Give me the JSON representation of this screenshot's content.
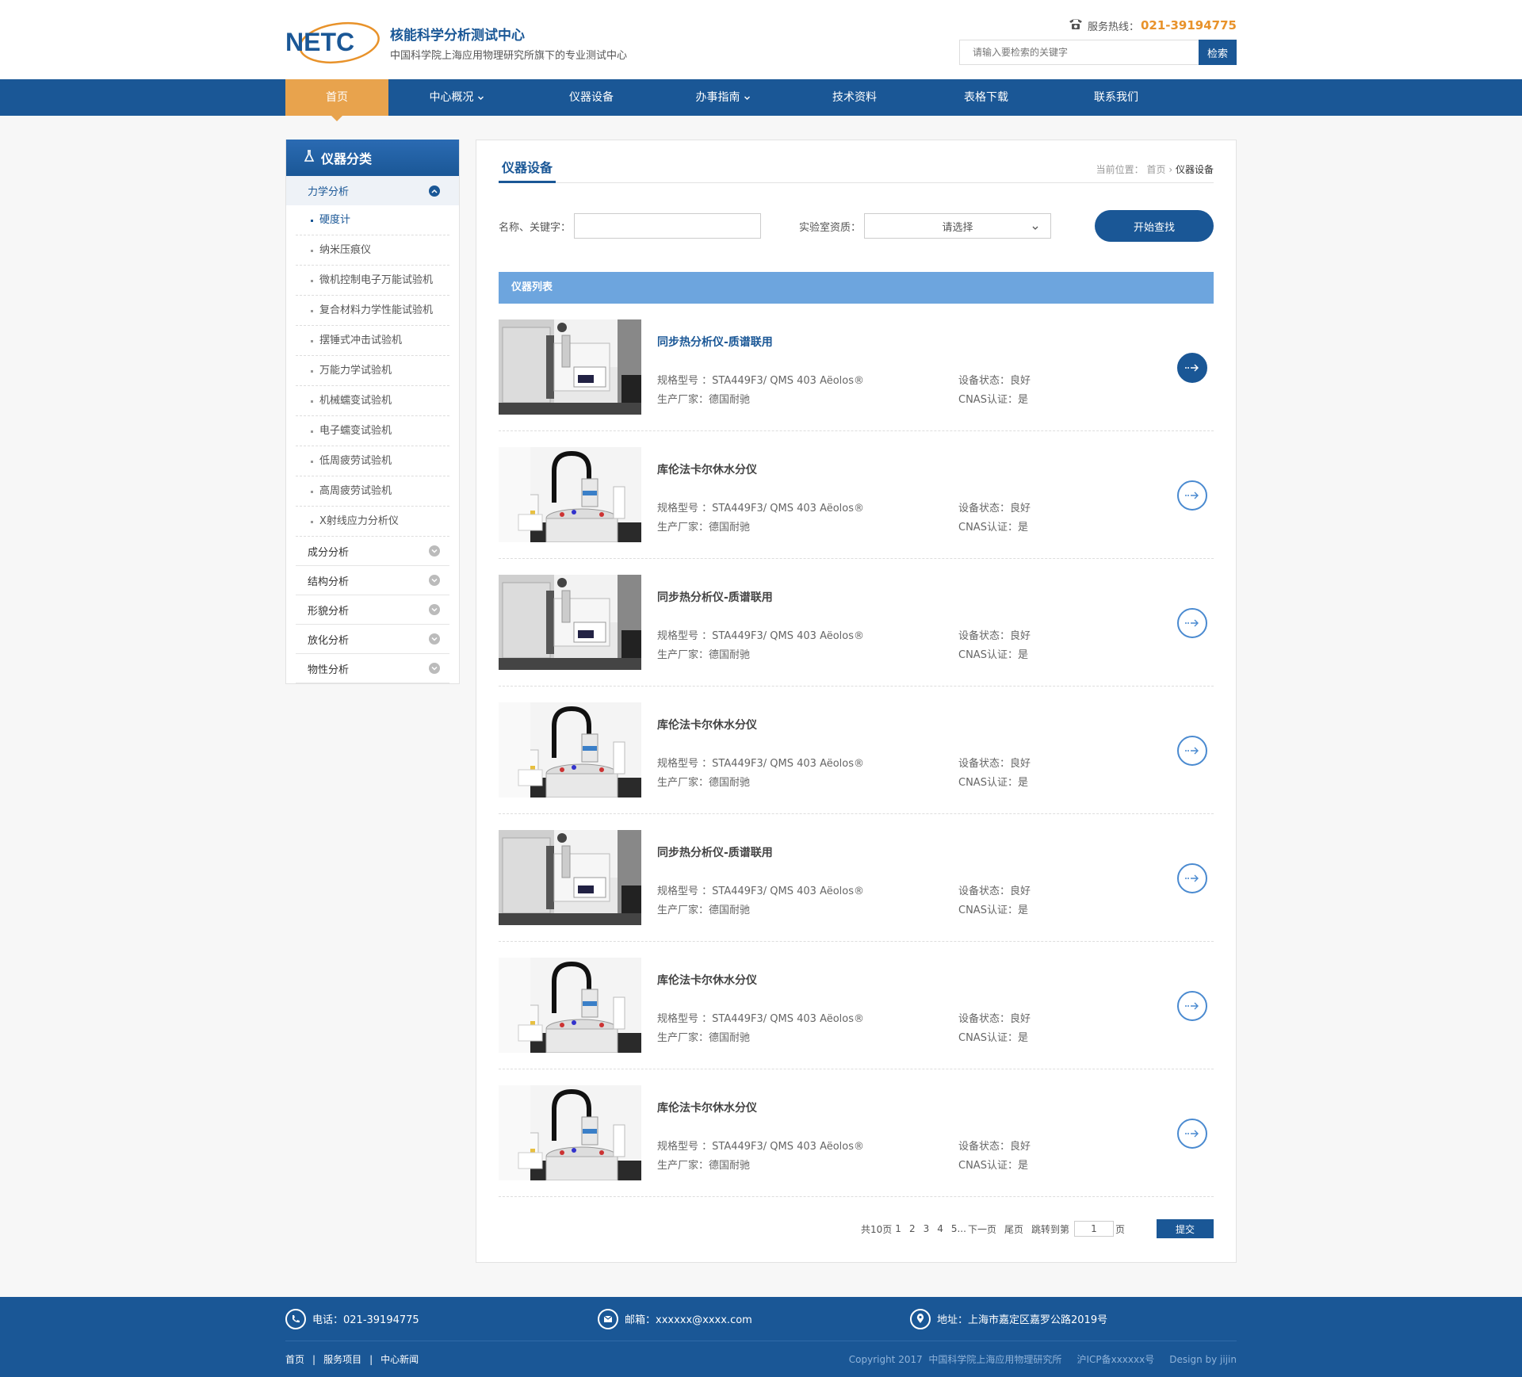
{
  "header": {
    "logo_text": "NETC",
    "title": "核能科学分析测试中心",
    "subtitle": "中国科学院上海应用物理研究所旗下的专业测试中心",
    "hotline_label": "服务热线：",
    "hotline_number": "021-39194775",
    "search_placeholder": "请输入要检索的关键字",
    "search_button": "检索"
  },
  "nav": [
    {
      "label": "首页",
      "active": true
    },
    {
      "label": "中心概况",
      "dropdown": true
    },
    {
      "label": "仪器设备"
    },
    {
      "label": "办事指南",
      "dropdown": true
    },
    {
      "label": "技术资料"
    },
    {
      "label": "表格下载"
    },
    {
      "label": "联系我们"
    }
  ],
  "sidebar": {
    "title": "仪器分类",
    "open_category": "力学分析",
    "sub_items": [
      "硬度计",
      "纳米压痕仪",
      "微机控制电子万能试验机",
      "复合材料力学性能试验机",
      "摆锤式冲击试验机",
      "万能力学试验机",
      "机械蠕变试验机",
      "电子蠕变试验机",
      "低周疲劳试验机",
      "高周疲劳试验机",
      "X射线应力分析仪"
    ],
    "categories": [
      "成分分析",
      "结构分析",
      "形貌分析",
      "放化分析",
      "物性分析"
    ]
  },
  "content": {
    "title": "仪器设备",
    "breadcrumb_prefix": "当前位置：",
    "breadcrumb_home": "首页",
    "breadcrumb_sep": "›",
    "breadcrumb_current": "仪器设备",
    "filter_name_label": "名称、关键字：",
    "filter_lab_label": "实验室资质：",
    "filter_select_value": "请选择",
    "search_button": "开始查找",
    "list_title": "仪器列表",
    "model_label": "规格型号 ：",
    "maker_label": "生产厂家：",
    "status_label": "设备状态：",
    "cnas_label": "CNAS认证：",
    "items": [
      {
        "name": "同步热分析仪-质谱联用",
        "model": "STA449F3/ QMS 403 Aëolos®",
        "maker": "德国耐驰",
        "status": "良好",
        "cnas": "是",
        "img": "sta",
        "active": true
      },
      {
        "name": "库伦法卡尔休水分仪",
        "model": "STA449F3/ QMS 403 Aëolos®",
        "maker": "德国耐驰",
        "status": "良好",
        "cnas": "是",
        "img": "kf"
      },
      {
        "name": "同步热分析仪-质谱联用",
        "model": "STA449F3/ QMS 403 Aëolos®",
        "maker": "德国耐驰",
        "status": "良好",
        "cnas": "是",
        "img": "sta"
      },
      {
        "name": "库伦法卡尔休水分仪",
        "model": "STA449F3/ QMS 403 Aëolos®",
        "maker": "德国耐驰",
        "status": "良好",
        "cnas": "是",
        "img": "kf"
      },
      {
        "name": "同步热分析仪-质谱联用",
        "model": "STA449F3/ QMS 403 Aëolos®",
        "maker": "德国耐驰",
        "status": "良好",
        "cnas": "是",
        "img": "sta"
      },
      {
        "name": "库伦法卡尔休水分仪",
        "model": "STA449F3/ QMS 403 Aëolos®",
        "maker": "德国耐驰",
        "status": "良好",
        "cnas": "是",
        "img": "kf"
      },
      {
        "name": "库伦法卡尔休水分仪",
        "model": "STA449F3/ QMS 403 Aëolos®",
        "maker": "德国耐驰",
        "status": "良好",
        "cnas": "是",
        "img": "kf"
      }
    ],
    "pager": {
      "total": "共10页",
      "pages": [
        "1",
        "2",
        "3",
        "4",
        "5..."
      ],
      "next": "下一页",
      "last": "尾页",
      "jump_label": "跳转到第",
      "jump_value": "1",
      "page_unit": "页",
      "submit": "提交"
    }
  },
  "footer": {
    "phone": "电话：021-39194775",
    "email": "邮箱：xxxxxx@xxxx.com",
    "address": "地址：上海市嘉定区嘉罗公路2019号",
    "links": [
      "首页",
      "服务项目",
      "中心新闻"
    ],
    "link_sep": "|",
    "copyright": "Copyright 2017  中国科学院上海应用物理研究所     沪ICP备xxxxxx号     Design by jijin"
  },
  "colors": {
    "brand": "#1a5796",
    "accent": "#e8a34d",
    "list_bar": "#6da5de"
  }
}
